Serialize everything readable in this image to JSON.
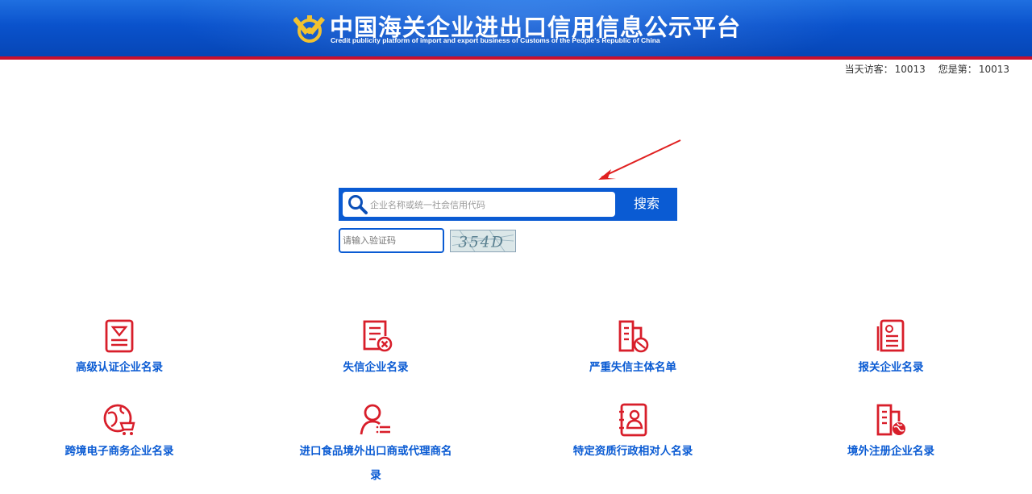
{
  "header": {
    "title": "中国海关企业进出口信用信息公示平台",
    "subtitle": "Credit publicity platform of import and export business of Customs of the People's Republic of China",
    "visitor_today_label": "当天访客：",
    "visitor_today_value": "10013",
    "visitor_number_label": "您是第：",
    "visitor_number_value": "10013"
  },
  "search": {
    "placeholder": "企业名称或统一社会信用代码",
    "button_label": "搜索",
    "captcha_placeholder": "请输入验证码",
    "captcha_text": "354D"
  },
  "categories": [
    {
      "label": "高级认证企业名录",
      "icon": "certificate-icon"
    },
    {
      "label": "失信企业名录",
      "icon": "document-cross-icon"
    },
    {
      "label": "严重失信主体名单",
      "icon": "building-prohibited-icon"
    },
    {
      "label": "报关企业名录",
      "icon": "customs-document-icon"
    },
    {
      "label": "跨境电子商务企业名录",
      "icon": "globe-cart-icon"
    },
    {
      "label": "进口食品境外出口商或代理商名录",
      "icon": "person-list-icon"
    },
    {
      "label": "特定资质行政相对人名录",
      "icon": "contact-card-icon"
    },
    {
      "label": "境外注册企业名录",
      "icon": "building-globe-icon"
    }
  ],
  "colors": {
    "banner_blue": "#0a52cc",
    "accent_red": "#d81e2a",
    "link_blue": "#0a5bd3"
  }
}
